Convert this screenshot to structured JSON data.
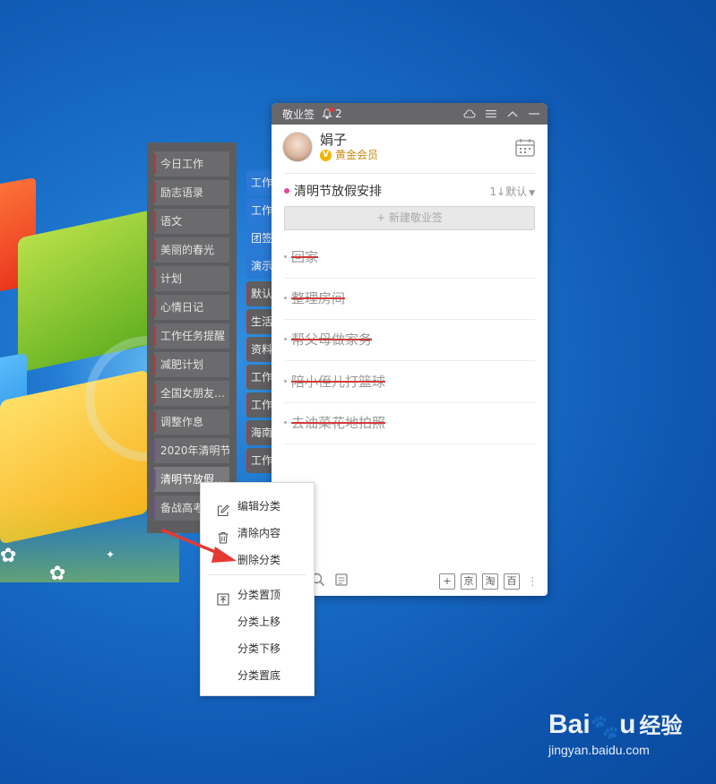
{
  "app": {
    "name": "敬业签",
    "reminder_count": "2",
    "user": {
      "name": "娟子",
      "membership": "黄金会员",
      "vip_badge": "V"
    },
    "list": {
      "title": "清明节放假安排",
      "sort_label": "1↓默认"
    },
    "new_note_button": "+ 新建敬业签",
    "todos": [
      "回家",
      "整理房间",
      "帮父母做家务",
      "陪小侄儿打篮球",
      "去油菜花地拍照"
    ],
    "bottom_bar": {
      "add": "+",
      "jd": "京",
      "taobao": "淘",
      "baidu": "百"
    }
  },
  "categories": [
    "今日工作",
    "励志语录",
    "语文",
    "美丽的春光",
    "计划",
    "心情日记",
    "工作任务提醒",
    "减肥计划",
    "全国女朋友…",
    "调整作息",
    "2020年清明节",
    "清明节放假…",
    "备战高考"
  ],
  "notes_column": [
    "工作",
    "工作",
    "团签",
    "演示",
    "默认",
    "生活",
    "资料",
    "工作",
    "工作",
    "海南",
    "工作"
  ],
  "context_menu": {
    "edit": "编辑分类",
    "clear": "清除内容",
    "delete": "删除分类",
    "top": "分类置顶",
    "up": "分类上移",
    "down": "分类下移",
    "bottom": "分类置底"
  },
  "watermark": {
    "logo": "Bai",
    "logo_tail": "u",
    "cn": "经验",
    "url": "jingyan.baidu.com"
  },
  "colors": {
    "accent_blue": "#2a79d6",
    "strike_red": "#d23b3b",
    "vip_gold": "#c98a12",
    "titlebar": "#67676a"
  }
}
